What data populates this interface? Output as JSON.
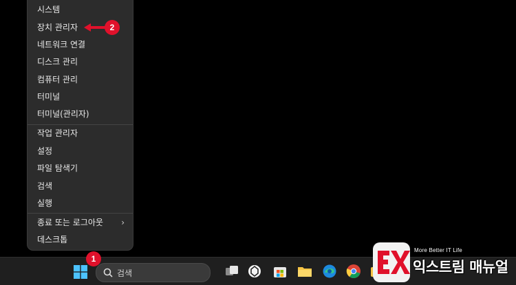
{
  "menu": {
    "items": [
      {
        "label": "시스템"
      },
      {
        "label": "장치 관리자"
      },
      {
        "label": "네트워크 연결"
      },
      {
        "label": "디스크 관리"
      },
      {
        "label": "컴퓨터 관리"
      },
      {
        "label": "터미널"
      },
      {
        "label": "터미널(관리자)"
      },
      {
        "label": "작업 관리자"
      },
      {
        "label": "설정"
      },
      {
        "label": "파일 탐색기"
      },
      {
        "label": "검색"
      },
      {
        "label": "실행"
      },
      {
        "label": "종료 또는 로그아웃",
        "submenu_icon": "chevron-right-icon"
      },
      {
        "label": "데스크톱"
      }
    ]
  },
  "callouts": {
    "one": "1",
    "two": "2"
  },
  "taskbar": {
    "search_label": "검색",
    "icons": [
      "windows-start-icon",
      "search-icon",
      "task-view-icon",
      "copilot-icon",
      "store-icon",
      "file-explorer-icon",
      "edge-icon",
      "chrome-icon",
      "folder-icon"
    ]
  },
  "watermark": {
    "subtitle": "More Better IT Life",
    "title": "익스트림 매뉴얼"
  },
  "colors": {
    "callout": "#e0112b",
    "menu_bg": "#2c2c2c",
    "taskbar_bg": "#1f1f1f"
  }
}
